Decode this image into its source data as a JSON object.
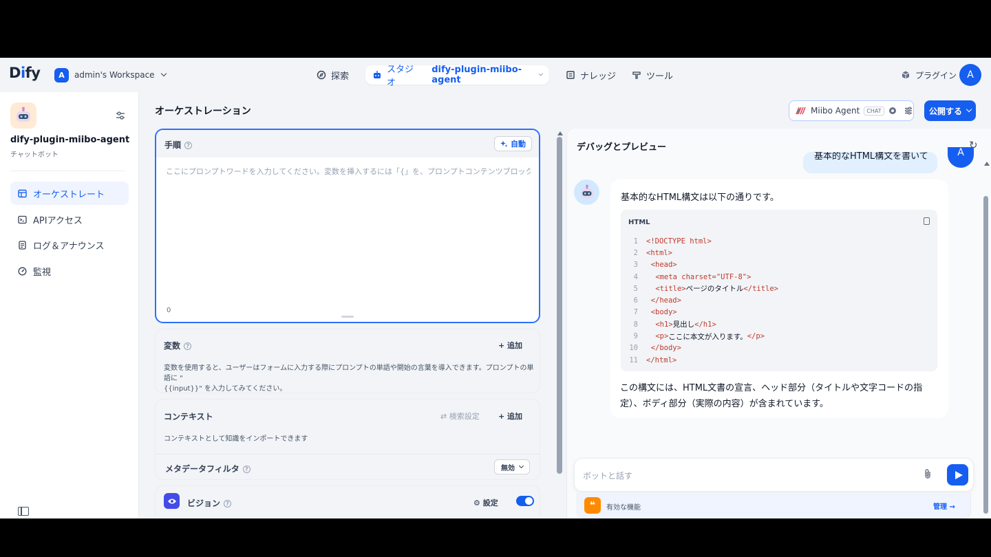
{
  "nav": {
    "logo_pre": "D",
    "logo_i": "i",
    "logo_post": "fy",
    "workspace_initial": "A",
    "workspace_name": "admin's Workspace",
    "explore": "探索",
    "studio": "スタジオ",
    "current_app": "dify-plugin-miibo-agent",
    "knowledge": "ナレッジ",
    "tools": "ツール",
    "plugins": "プラグイン",
    "user_initial": "A"
  },
  "sidebar": {
    "app_name": "dify-plugin-miibo-agent",
    "app_type": "チャットボット",
    "items": [
      {
        "label": "オーケストレート",
        "icon": "layout-icon",
        "active": true
      },
      {
        "label": "APIアクセス",
        "icon": "terminal-icon",
        "active": false
      },
      {
        "label": "ログ＆アナウンス",
        "icon": "doc-icon",
        "active": false
      },
      {
        "label": "監視",
        "icon": "monitor-icon",
        "active": false
      }
    ]
  },
  "orchestration": {
    "title": "オーケストレーション",
    "instructions": {
      "label": "手順",
      "auto_label": "自動",
      "placeholder": "ここにプロンプトワードを入力してください。変数を挿入するには「{」を、プロンプトコンテンツブロックを挿入するには...",
      "char_count": "0"
    },
    "variables": {
      "label": "変数",
      "add_label": "追加",
      "description_line1": "変数を使用すると、ユーザーはフォームに入力する際にプロンプトの単語や開始の言葉を導入できます。プロンプトの単語に \"",
      "description_line2": "{{input}}\" を入力してみてください。"
    },
    "context": {
      "label": "コンテキスト",
      "retrieval_settings": "検索設定",
      "add_label": "追加",
      "description": "コンテキストとして知識をインポートできます",
      "metadata_filter_label": "メタデータフィルタ",
      "metadata_filter_value": "無効"
    },
    "vision": {
      "label": "ビジョン",
      "settings_label": "設定",
      "enabled": true
    }
  },
  "header_right": {
    "model_name": "Miibo Agent",
    "model_tag": "CHAT",
    "publish_label": "公開する"
  },
  "debug": {
    "title": "デバッグとプレビュー",
    "user_message": "基本的なHTML構文を書いて",
    "user_initial": "A",
    "answer_intro": "基本的なHTML構文は以下の通りです。",
    "code_lang": "HTML",
    "code_lines": [
      {
        "n": "1",
        "parts": [
          {
            "t": "<!DOCTYPE html>",
            "c": "tag"
          }
        ]
      },
      {
        "n": "2",
        "parts": [
          {
            "t": "<html>",
            "c": "tag"
          }
        ]
      },
      {
        "n": "3",
        "parts": [
          {
            "t": "  ",
            "c": "txt"
          },
          {
            "t": "<head>",
            "c": "tag"
          }
        ]
      },
      {
        "n": "4",
        "parts": [
          {
            "t": "    ",
            "c": "txt"
          },
          {
            "t": "<meta charset=\"UTF-8\">",
            "c": "tag"
          }
        ]
      },
      {
        "n": "5",
        "parts": [
          {
            "t": "    ",
            "c": "txt"
          },
          {
            "t": "<title>",
            "c": "tag"
          },
          {
            "t": "ページのタイトル",
            "c": "txt"
          },
          {
            "t": "</title>",
            "c": "tag"
          }
        ]
      },
      {
        "n": "6",
        "parts": [
          {
            "t": "  ",
            "c": "txt"
          },
          {
            "t": "</head>",
            "c": "tag"
          }
        ]
      },
      {
        "n": "7",
        "parts": [
          {
            "t": "  ",
            "c": "txt"
          },
          {
            "t": "<body>",
            "c": "tag"
          }
        ]
      },
      {
        "n": "8",
        "parts": [
          {
            "t": "    ",
            "c": "txt"
          },
          {
            "t": "<h1>",
            "c": "tag"
          },
          {
            "t": "見出し",
            "c": "txt"
          },
          {
            "t": "</h1>",
            "c": "tag"
          }
        ]
      },
      {
        "n": "9",
        "parts": [
          {
            "t": "    ",
            "c": "txt"
          },
          {
            "t": "<p>",
            "c": "tag"
          },
          {
            "t": "ここに本文が入ります。",
            "c": "txt"
          },
          {
            "t": "</p>",
            "c": "tag"
          }
        ]
      },
      {
        "n": "10",
        "parts": [
          {
            "t": "  ",
            "c": "txt"
          },
          {
            "t": "</body>",
            "c": "tag"
          }
        ]
      },
      {
        "n": "11",
        "parts": [
          {
            "t": "</html>",
            "c": "tag"
          }
        ]
      }
    ],
    "answer_outro": "この構文には、HTML文書の宣言、ヘッド部分（タイトルや文字コードの指定）、ボディ部分（実際の内容）が含まれています。",
    "input_placeholder": "ボットと話す",
    "features_label": "有効な機能",
    "manage_label": "管理 →"
  },
  "colors": {
    "accent": "#155eef",
    "code_tag": "#c0392b"
  }
}
